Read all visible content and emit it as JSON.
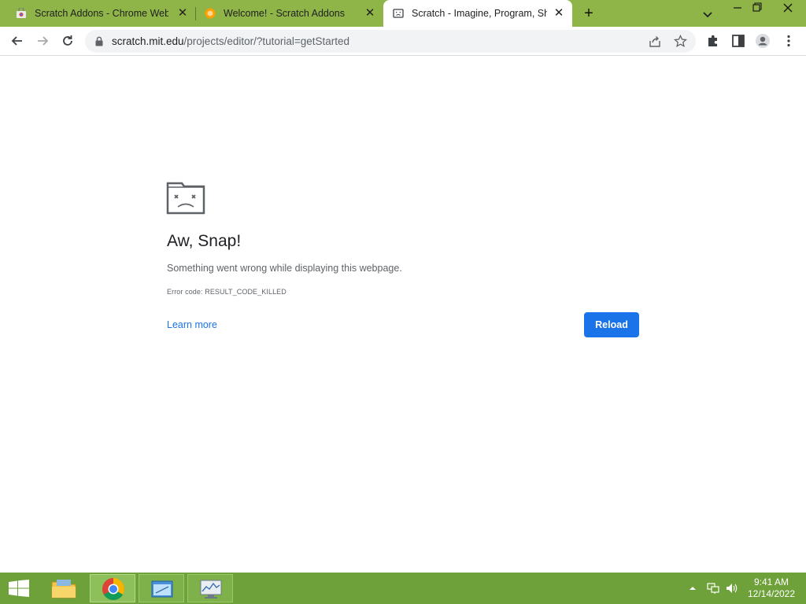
{
  "browser": {
    "tabs": [
      {
        "title": "Scratch Addons - Chrome Web S",
        "active": false
      },
      {
        "title": "Welcome! - Scratch Addons",
        "active": false
      },
      {
        "title": "Scratch - Imagine, Program, Shar",
        "active": true
      }
    ],
    "new_tab_label": "+",
    "url_host": "scratch.mit.edu",
    "url_path": "/projects/editor/?tutorial=getStarted"
  },
  "error_page": {
    "title": "Aw, Snap!",
    "description": "Something went wrong while displaying this webpage.",
    "error_code": "Error code: RESULT_CODE_KILLED",
    "learn_more": "Learn more",
    "reload_label": "Reload"
  },
  "taskbar": {
    "time": "9:41 AM",
    "date": "12/14/2022"
  },
  "colors": {
    "tab_strip": "#8fb549",
    "taskbar": "#6ea13a",
    "accent": "#1a73e8"
  }
}
